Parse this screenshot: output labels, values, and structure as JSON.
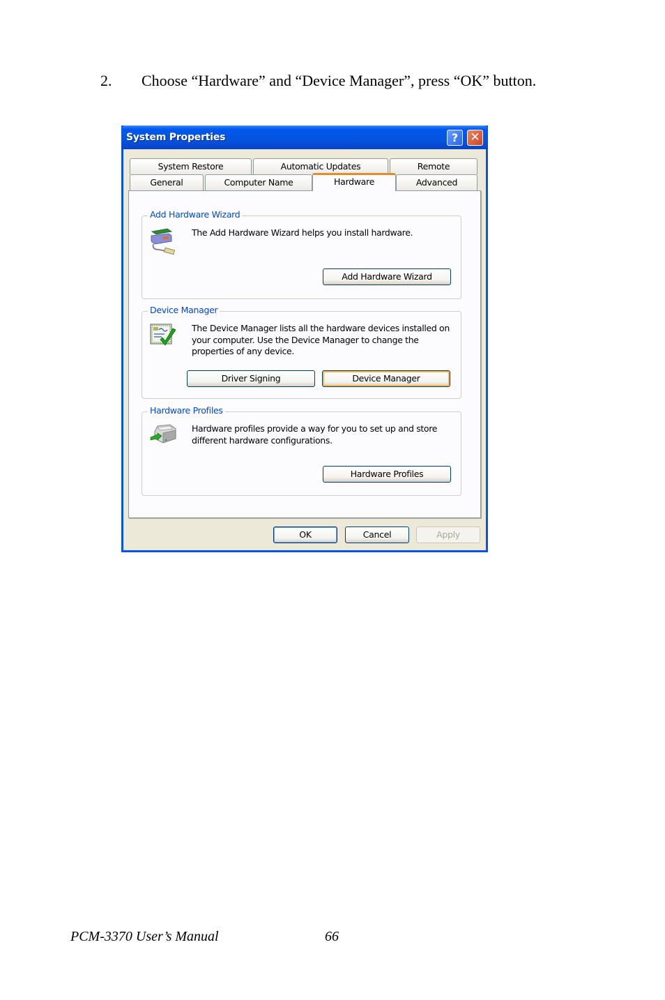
{
  "instruction": {
    "number": "2.",
    "text": "Choose “Hardware” and “Device Manager”, press “OK” button."
  },
  "window": {
    "title": "System Properties",
    "help_icon": "help-icon",
    "close_icon": "close-icon",
    "help_glyph": "?",
    "close_glyph": "✕",
    "tabs_row1": [
      {
        "label": "System Restore"
      },
      {
        "label": "Automatic Updates"
      },
      {
        "label": "Remote"
      }
    ],
    "tabs_row2": [
      {
        "label": "General"
      },
      {
        "label": "Computer Name"
      },
      {
        "label": "Hardware",
        "active": true
      },
      {
        "label": "Advanced"
      }
    ],
    "groups": {
      "add_hardware": {
        "label": "Add Hardware Wizard",
        "icon": "add-hardware-icon",
        "text": "The Add Hardware Wizard helps you install hardware.",
        "button": "Add Hardware Wizard"
      },
      "device_manager": {
        "label": "Device Manager",
        "icon": "device-manager-icon",
        "text": "The Device Manager lists all the hardware devices installed on your computer. Use the Device Manager to change the properties of any device.",
        "buttons": [
          "Driver Signing",
          "Device Manager"
        ]
      },
      "hardware_profiles": {
        "label": "Hardware Profiles",
        "icon": "hardware-profiles-icon",
        "text": "Hardware profiles provide a way for you to set up and store different hardware configurations.",
        "button": "Hardware Profiles"
      }
    },
    "footer_buttons": {
      "ok": "OK",
      "cancel": "Cancel",
      "apply": "Apply"
    },
    "colors": {
      "titlebar": "#0553e0",
      "group_label": "#0046d5",
      "active_tab_accent": "#e68b2c",
      "dialog_bg": "#ece9d8"
    }
  },
  "footer": {
    "manual": "PCM-3370 User’s Manual",
    "page": "66"
  }
}
